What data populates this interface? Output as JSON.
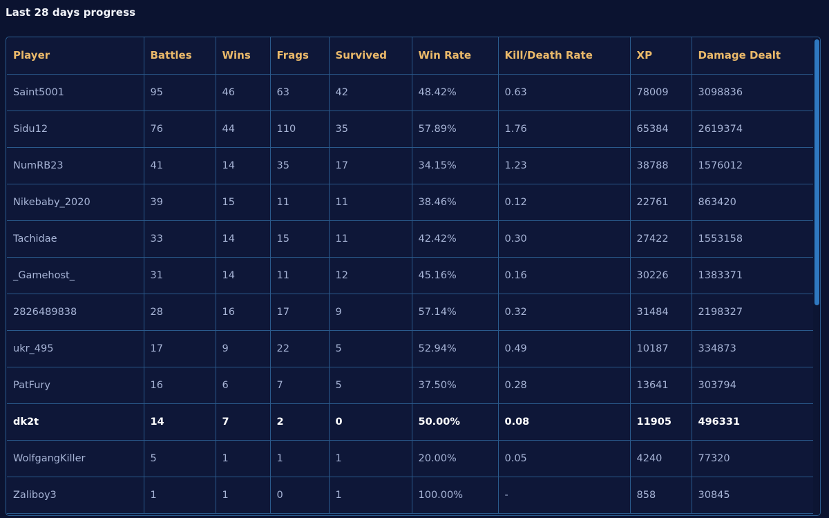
{
  "title": "Last 28 days progress",
  "columns": [
    "Player",
    "Battles",
    "Wins",
    "Frags",
    "Survived",
    "Win Rate",
    "Kill/Death Rate",
    "XP",
    "Damage Dealt"
  ],
  "rows": [
    {
      "player": "Saint5001",
      "battles": "95",
      "wins": "46",
      "frags": "63",
      "survived": "42",
      "win_rate": "48.42%",
      "kd": "0.63",
      "xp": "78009",
      "damage": "3098836"
    },
    {
      "player": "Sidu12",
      "battles": "76",
      "wins": "44",
      "frags": "110",
      "survived": "35",
      "win_rate": "57.89%",
      "kd": "1.76",
      "xp": "65384",
      "damage": "2619374"
    },
    {
      "player": "NumRB23",
      "battles": "41",
      "wins": "14",
      "frags": "35",
      "survived": "17",
      "win_rate": "34.15%",
      "kd": "1.23",
      "xp": "38788",
      "damage": "1576012"
    },
    {
      "player": "Nikebaby_2020",
      "battles": "39",
      "wins": "15",
      "frags": "11",
      "survived": "11",
      "win_rate": "38.46%",
      "kd": "0.12",
      "xp": "22761",
      "damage": "863420"
    },
    {
      "player": "Tachidae",
      "battles": "33",
      "wins": "14",
      "frags": "15",
      "survived": "11",
      "win_rate": "42.42%",
      "kd": "0.30",
      "xp": "27422",
      "damage": "1553158"
    },
    {
      "player": "_Gamehost_",
      "battles": "31",
      "wins": "14",
      "frags": "11",
      "survived": "12",
      "win_rate": "45.16%",
      "kd": "0.16",
      "xp": "30226",
      "damage": "1383371"
    },
    {
      "player": "2826489838",
      "battles": "28",
      "wins": "16",
      "frags": "17",
      "survived": "9",
      "win_rate": "57.14%",
      "kd": "0.32",
      "xp": "31484",
      "damage": "2198327"
    },
    {
      "player": "ukr_495",
      "battles": "17",
      "wins": "9",
      "frags": "22",
      "survived": "5",
      "win_rate": "52.94%",
      "kd": "0.49",
      "xp": "10187",
      "damage": "334873"
    },
    {
      "player": "PatFury",
      "battles": "16",
      "wins": "6",
      "frags": "7",
      "survived": "5",
      "win_rate": "37.50%",
      "kd": "0.28",
      "xp": "13641",
      "damage": "303794"
    },
    {
      "player": "dk2t",
      "battles": "14",
      "wins": "7",
      "frags": "2",
      "survived": "0",
      "win_rate": "50.00%",
      "kd": "0.08",
      "xp": "11905",
      "damage": "496331"
    },
    {
      "player": "WolfgangKiller",
      "battles": "5",
      "wins": "1",
      "frags": "1",
      "survived": "1",
      "win_rate": "20.00%",
      "kd": "0.05",
      "xp": "4240",
      "damage": "77320"
    },
    {
      "player": "Zaliboy3",
      "battles": "1",
      "wins": "1",
      "frags": "0",
      "survived": "1",
      "win_rate": "100.00%",
      "kd": "-",
      "xp": "858",
      "damage": "30845"
    }
  ],
  "highlighted_player": "dk2t",
  "colors": {
    "background": "#0b1330",
    "header_text": "#eab96a",
    "cell_text": "#a7b4d6",
    "highlight_text": "#ffffff",
    "grid": "#2a5a8c",
    "scrollbar": "#2f78c0"
  }
}
